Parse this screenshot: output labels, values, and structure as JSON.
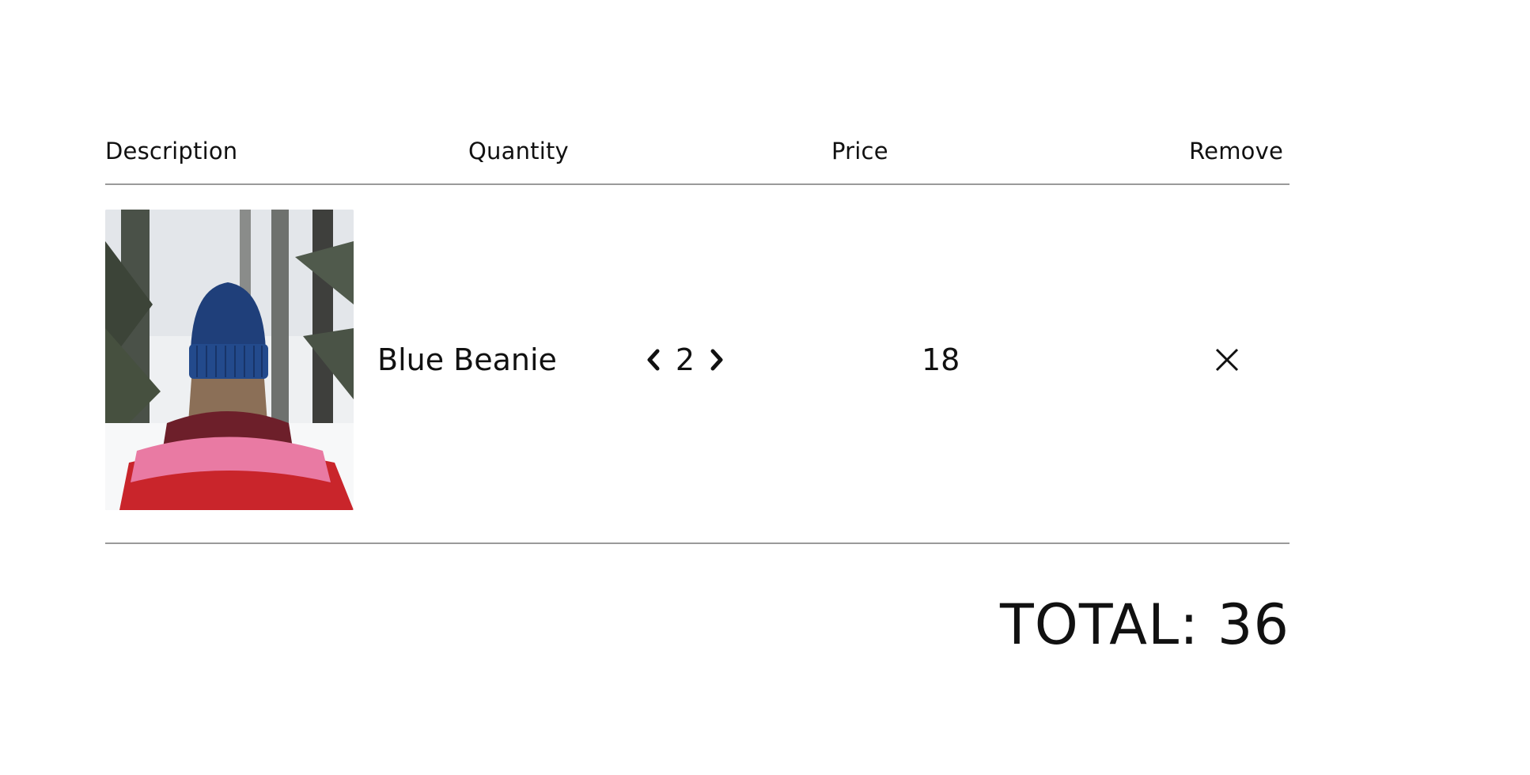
{
  "table": {
    "headers": {
      "description": "Description",
      "quantity": "Quantity",
      "price": "Price",
      "remove": "Remove"
    }
  },
  "items": [
    {
      "name": "Blue Beanie",
      "quantity": "2",
      "price": "18",
      "image_icon": "product-photo-blue-beanie",
      "decrement_icon": "chevron-left-icon",
      "increment_icon": "chevron-right-icon",
      "remove_icon": "close-icon"
    }
  ],
  "summary": {
    "total_label": "TOTAL:",
    "total_value": "36"
  },
  "colors": {
    "text": "#111111",
    "rule": "#9a9a9a",
    "background": "#ffffff"
  }
}
